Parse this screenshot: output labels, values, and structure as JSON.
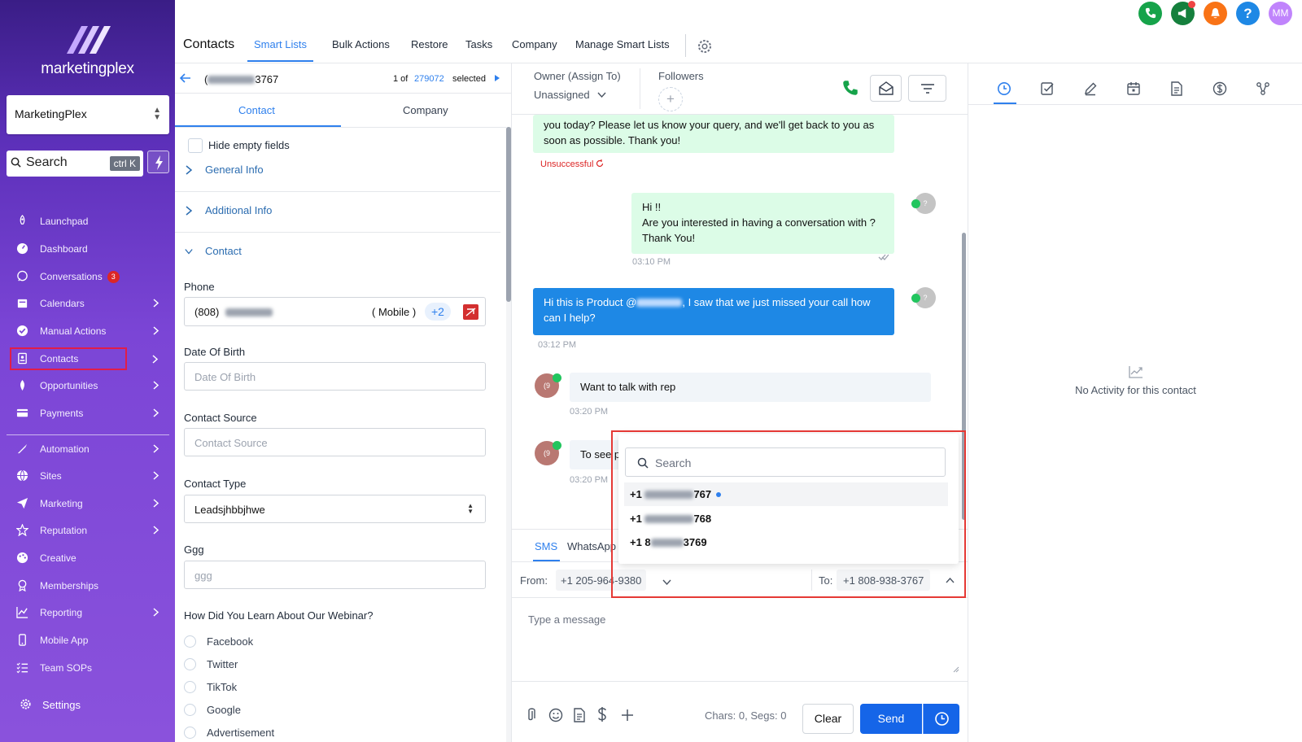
{
  "sidebar": {
    "brand": "marketingplex",
    "account": "MarketingPlex",
    "search_placeholder": "Search",
    "search_shortcut": "ctrl K",
    "items": [
      {
        "label": "Launchpad"
      },
      {
        "label": "Dashboard"
      },
      {
        "label": "Conversations",
        "badge": "3"
      },
      {
        "label": "Calendars"
      },
      {
        "label": "Manual Actions"
      },
      {
        "label": "Contacts"
      },
      {
        "label": "Opportunities"
      },
      {
        "label": "Payments"
      },
      {
        "label": "Automation"
      },
      {
        "label": "Sites"
      },
      {
        "label": "Marketing"
      },
      {
        "label": "Reputation"
      },
      {
        "label": "Creative"
      },
      {
        "label": "Memberships"
      },
      {
        "label": "Reporting"
      },
      {
        "label": "Mobile App"
      },
      {
        "label": "Team SOPs"
      }
    ],
    "settings": "Settings"
  },
  "header": {
    "title": "Contacts",
    "tabs": [
      "Smart Lists",
      "Bulk Actions",
      "Restore",
      "Tasks",
      "Company",
      "Manage Smart Lists"
    ],
    "user_initials": "MM"
  },
  "contact_panel": {
    "phone_suffix": "3767",
    "pager_prefix": "1 of",
    "pager_total": "279072",
    "pager_suffix": "selected",
    "tabs": [
      "Contact",
      "Company"
    ],
    "hide_empty": "Hide empty fields",
    "sections": [
      "General Info",
      "Additional Info",
      "Contact"
    ],
    "phone_label": "Phone",
    "phone_prefix": "(808)",
    "phone_type": "( Mobile )",
    "phone_more": "+2",
    "dob_label": "Date Of Birth",
    "dob_placeholder": "Date Of Birth",
    "source_label": "Contact Source",
    "source_placeholder": "Contact Source",
    "type_label": "Contact Type",
    "type_value": "Leadsjhbbjhwe",
    "ggg_label": "Ggg",
    "ggg_placeholder": "ggg",
    "webinar_label": "How Did You Learn About Our Webinar?",
    "webinar_options": [
      "Facebook",
      "Twitter",
      "TikTok",
      "Google",
      "Advertisement"
    ]
  },
  "conversation": {
    "owner_label": "Owner (Assign To)",
    "owner_value": "Unassigned",
    "followers_label": "Followers",
    "messages": [
      {
        "text": "you today? Please let us know your query, and we'll get back to you as soon as possible. Thank you!",
        "status": "Unsuccessful"
      },
      {
        "line1": "Hi !!",
        "line2": "Are you interested in having a conversation with ?",
        "line3": "Thank You!",
        "time": "03:10 PM"
      },
      {
        "prefix": "Hi this is Product @",
        "suffix": ", I saw that we just missed your call how can I help?",
        "time": "03:12 PM"
      },
      {
        "text": "Want to talk with rep",
        "time": "03:20 PM"
      },
      {
        "text": "To see p",
        "time": "03:20 PM"
      }
    ],
    "avatar_initial": "?",
    "contact_avatar": "(9",
    "channels": [
      "SMS",
      "WhatsApp"
    ],
    "from_label": "From:",
    "from_number": "+1 205-964-9380",
    "to_label": "To:",
    "to_number": "+1 808-938-3767",
    "message_placeholder": "Type a message",
    "chars": "Chars: 0, Segs: 0",
    "clear": "Clear",
    "send": "Send",
    "dropdown": {
      "search_placeholder": "Search",
      "items": [
        {
          "prefix": "+1",
          "suffix": "767"
        },
        {
          "prefix": "+1",
          "suffix": "768"
        },
        {
          "prefix": "+1 8",
          "suffix": "3769"
        }
      ]
    }
  },
  "activity": {
    "empty": "No Activity for this contact"
  },
  "colors": {
    "accent": "#2f80ed",
    "send": "#1565e8",
    "bubble_green": "#dcfce7",
    "bubble_blue": "#1e88e5",
    "highlight": "#e53935"
  }
}
